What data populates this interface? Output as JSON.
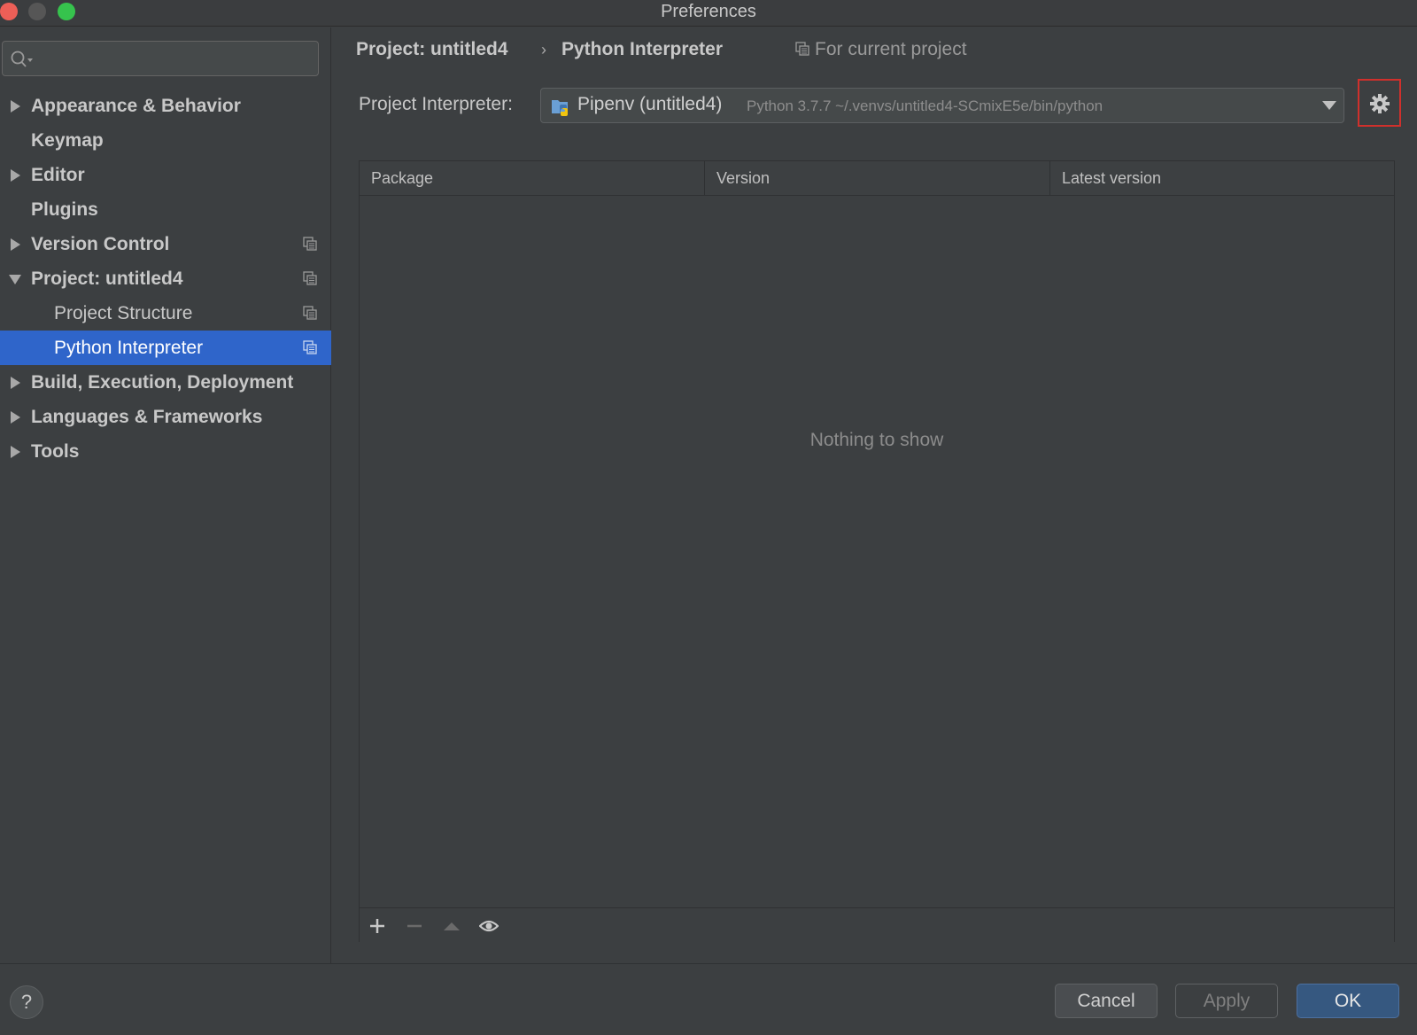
{
  "window": {
    "title": "Preferences"
  },
  "sidebar": {
    "search": {
      "placeholder": ""
    },
    "items": [
      {
        "label": "Appearance & Behavior",
        "expander": "collapsed",
        "bold": true
      },
      {
        "label": "Keymap",
        "expander": "none",
        "bold": true
      },
      {
        "label": "Editor",
        "expander": "collapsed",
        "bold": true
      },
      {
        "label": "Plugins",
        "expander": "none",
        "bold": true
      },
      {
        "label": "Version Control",
        "expander": "collapsed",
        "bold": true,
        "project_icon": true
      },
      {
        "label": "Project: untitled4",
        "expander": "expanded",
        "bold": true,
        "project_icon": true
      },
      {
        "label": "Project Structure",
        "child": true,
        "project_icon": true
      },
      {
        "label": "Python Interpreter",
        "child": true,
        "project_icon": true,
        "selected": true
      },
      {
        "label": "Build, Execution, Deployment",
        "expander": "collapsed",
        "bold": true
      },
      {
        "label": "Languages & Frameworks",
        "expander": "collapsed",
        "bold": true
      },
      {
        "label": "Tools",
        "expander": "collapsed",
        "bold": true
      }
    ]
  },
  "main": {
    "breadcrumb": {
      "parent": "Project: untitled4",
      "separator": "›",
      "current": "Python Interpreter"
    },
    "scope_label": "For current project",
    "interpreter": {
      "label": "Project Interpreter:",
      "name": "Pipenv (untitled4)",
      "detail": "Python 3.7.7 ~/.venvs/untitled4-SCmixE5e/bin/python"
    },
    "table": {
      "columns": [
        "Package",
        "Version",
        "Latest version"
      ],
      "empty_text": "Nothing to show",
      "toolbar_icons": [
        "plus-icon",
        "minus-icon",
        "upgrade-icon",
        "eye-icon"
      ]
    }
  },
  "footer": {
    "help_label": "?",
    "cancel_label": "Cancel",
    "apply_label": "Apply",
    "ok_label": "OK"
  },
  "colors": {
    "selection": "#2f65ca",
    "highlight_border": "#d0302c",
    "ok_button": "#365880"
  }
}
